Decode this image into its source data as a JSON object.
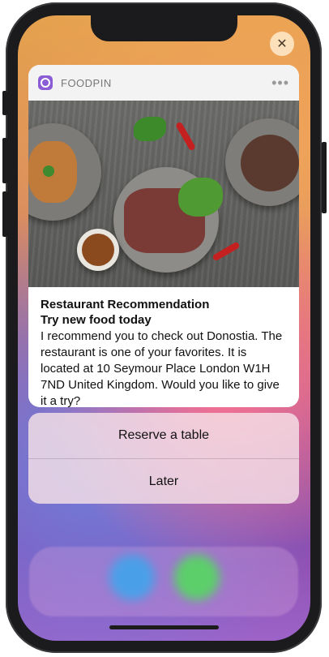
{
  "notification": {
    "app_name": "FOODPIN",
    "more_label": "•••",
    "title": "Restaurant Recommendation",
    "subtitle": "Try new food today",
    "body": "I recommend you to check out Donostia. The restaurant is one of your favorites. It is located at 10 Seymour Place London W1H 7ND United Kingdom. Would you like to give it a try?"
  },
  "actions": [
    {
      "label": "Reserve a table"
    },
    {
      "label": "Later"
    }
  ],
  "close_label": "✕",
  "colors": {
    "app_icon": "#8a5cd6",
    "dock_blue": "#4aa0e8",
    "dock_green": "#5ccf6a"
  },
  "icons": {
    "app": "foodpin-app-icon",
    "close": "close-icon",
    "more": "more-options-icon"
  }
}
